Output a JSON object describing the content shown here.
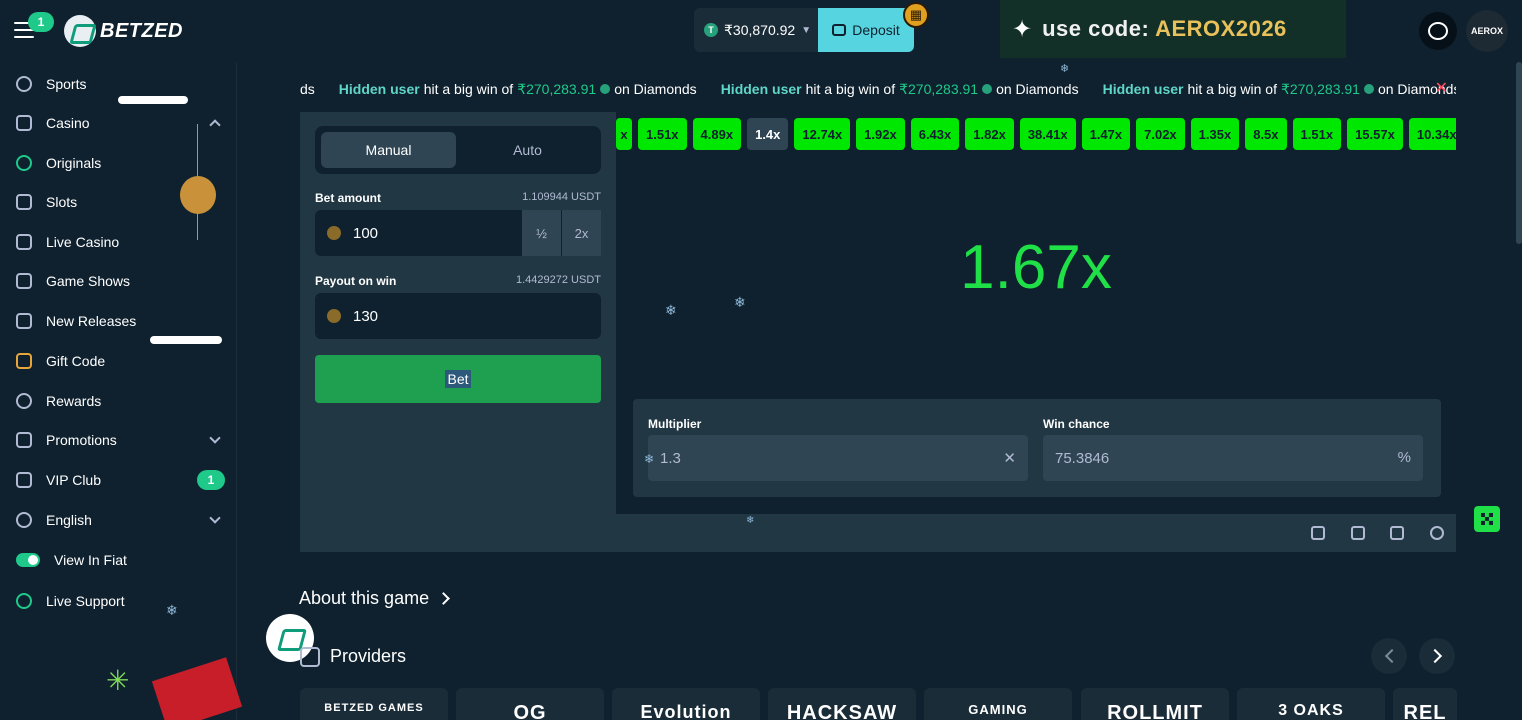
{
  "header": {
    "notif_count": "1",
    "logo_text": "BETZED",
    "balance": "₹30,870.92",
    "currency_symbol": "T",
    "deposit_label": "Deposit",
    "promo_prefix": "use code: ",
    "promo_code": "AEROX2026",
    "avatar_text": "AEROX"
  },
  "sidebar": {
    "items": [
      {
        "label": "Sports"
      },
      {
        "label": "Casino"
      },
      {
        "label": "Originals"
      },
      {
        "label": "Slots"
      },
      {
        "label": "Live Casino"
      },
      {
        "label": "Game Shows"
      },
      {
        "label": "New Releases"
      },
      {
        "label": "Gift Code"
      },
      {
        "label": "Rewards"
      },
      {
        "label": "Promotions"
      },
      {
        "label": "VIP Club"
      },
      {
        "label": "English"
      },
      {
        "label": "View In Fiat"
      },
      {
        "label": "Live Support"
      }
    ],
    "vip_badge": "1"
  },
  "ticker": {
    "partial": "ds",
    "user": "Hidden user",
    "text_a": "hit a big win of",
    "amount": "₹270,283.91",
    "text_b": "on Diamonds",
    "text_b_cut": "on Diamonds"
  },
  "game": {
    "tabs": [
      "Manual",
      "Auto"
    ],
    "bet_amount_label": "Bet amount",
    "bet_amount_sub": "1.109944 USDT",
    "bet_amount_value": "100",
    "half_label": "½",
    "double_label": "2x",
    "payout_label": "Payout on win",
    "payout_sub": "1.4429272 USDT",
    "payout_value": "130",
    "bet_button": "Bet",
    "history": [
      "x",
      "1.51x",
      "4.89x",
      "1.4x",
      "12.74x",
      "1.92x",
      "6.43x",
      "1.82x",
      "38.41x",
      "1.47x",
      "7.02x",
      "1.35x",
      "8.5x",
      "1.51x",
      "15.57x",
      "10.34x"
    ],
    "result": "1.67x",
    "multiplier_label": "Multiplier",
    "multiplier_value": "1.3",
    "multiplier_suffix": "✕",
    "win_chance_label": "Win chance",
    "win_chance_value": "75.3846",
    "win_chance_suffix": "%"
  },
  "below": {
    "about_label": "About this game",
    "providers_label": "Providers",
    "provider_cards": [
      "BETZED GAMES",
      "OG",
      "Evolution",
      "HACKSAW",
      "GAMING",
      "ROLLMIT",
      "3 OAKS",
      "REL"
    ]
  },
  "colors": {
    "accent_green": "#00e701",
    "deposit": "#56d4df",
    "badge": "#1ec98a"
  }
}
